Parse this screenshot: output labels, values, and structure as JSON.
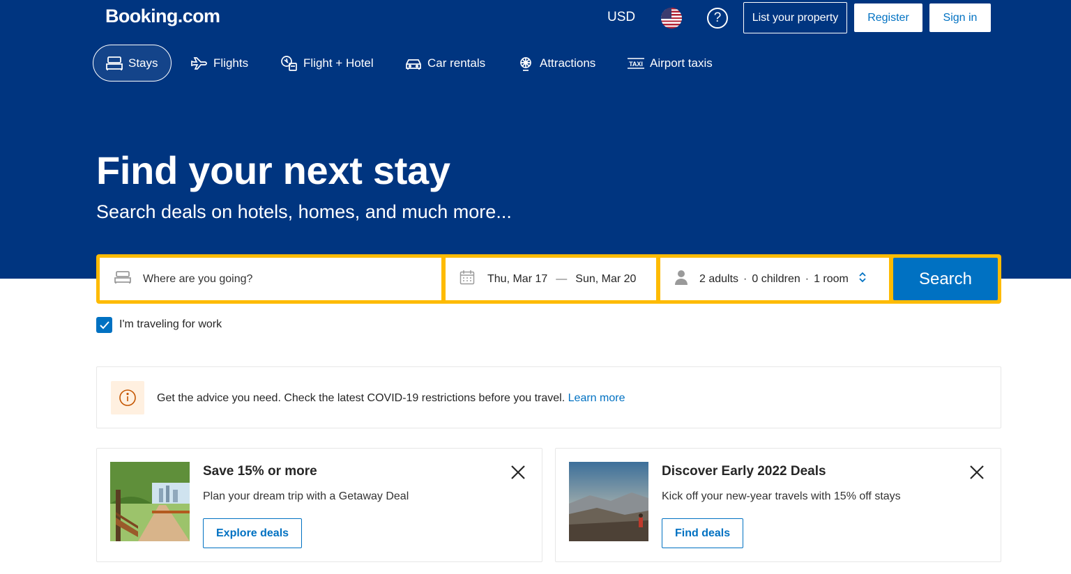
{
  "header": {
    "logo": "Booking.com",
    "currency": "USD",
    "flag_icon": "us-flag-icon",
    "help_icon": "question-circle-icon",
    "help_glyph": "?",
    "list_property": "List your property",
    "register": "Register",
    "sign_in": "Sign in"
  },
  "nav": {
    "tabs": [
      {
        "label": "Stays",
        "icon": "bed-icon",
        "active": true
      },
      {
        "label": "Flights",
        "icon": "plane-icon",
        "active": false
      },
      {
        "label": "Flight + Hotel",
        "icon": "flight-hotel-icon",
        "active": false
      },
      {
        "label": "Car rentals",
        "icon": "car-icon",
        "active": false
      },
      {
        "label": "Attractions",
        "icon": "attractions-icon",
        "active": false
      },
      {
        "label": "Airport taxis",
        "icon": "taxi-icon",
        "active": false
      }
    ]
  },
  "hero": {
    "title": "Find your next stay",
    "subtitle": "Search deals on hotels, homes, and much more..."
  },
  "search": {
    "destination_placeholder": "Where are you going?",
    "checkin": "Thu, Mar 17",
    "date_separator": "—",
    "checkout": "Sun, Mar 20",
    "adults": "2 adults",
    "children": "0 children",
    "rooms": "1 room",
    "separator": "·",
    "button": "Search"
  },
  "work_travel": {
    "label": "I'm traveling for work",
    "checked": true
  },
  "notice": {
    "text": "Get the advice you need. Check the latest COVID-19 restrictions before you travel.",
    "link": "Learn more"
  },
  "deals": [
    {
      "title": "Save 15% or more",
      "description": "Plan your dream trip with a Getaway Deal",
      "button": "Explore deals"
    },
    {
      "title": "Discover Early 2022 Deals",
      "description": "Kick off your new-year travels with 15% off stays",
      "button": "Find deals"
    }
  ],
  "colors": {
    "brand_blue": "#003580",
    "action_blue": "#0071c2",
    "search_border": "#febb02"
  }
}
